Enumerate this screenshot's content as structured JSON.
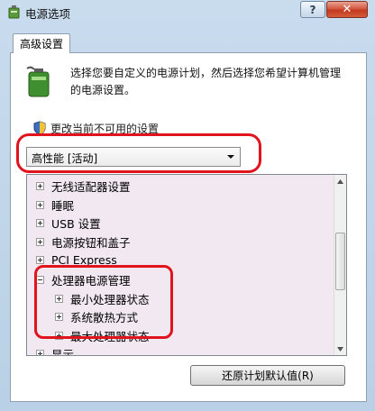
{
  "window": {
    "title": "电源选项",
    "help_label": "?",
    "close_label": "✕"
  },
  "tab": {
    "label": "高级设置"
  },
  "description": {
    "line1": "选择您要自定义的电源计划，然后选择您希望计算机管理",
    "line2": "的电源设置。"
  },
  "change_link": "更改当前不可用的设置",
  "plan_select": {
    "value": "高性能 [活动]"
  },
  "tree": {
    "items": [
      {
        "label": "无线适配器设置",
        "expanded": false,
        "level": 0
      },
      {
        "label": "睡眠",
        "expanded": false,
        "level": 0
      },
      {
        "label": "USB 设置",
        "expanded": false,
        "level": 0
      },
      {
        "label": "电源按钮和盖子",
        "expanded": false,
        "level": 0
      },
      {
        "label": "PCI Express",
        "expanded": false,
        "level": 0
      },
      {
        "label": "处理器电源管理",
        "expanded": true,
        "level": 0
      },
      {
        "label": "最小处理器状态",
        "expanded": false,
        "level": 1
      },
      {
        "label": "系统散热方式",
        "expanded": false,
        "level": 1
      },
      {
        "label": "最大处理器状态",
        "expanded": false,
        "level": 1
      },
      {
        "label": "显示",
        "expanded": false,
        "level": 0
      }
    ]
  },
  "restore_button": "还原计划默认值(R)",
  "colors": {
    "annotation": "#e1141e",
    "tree_highlight": "#f1e8f1",
    "close_button": "#c23a20"
  }
}
